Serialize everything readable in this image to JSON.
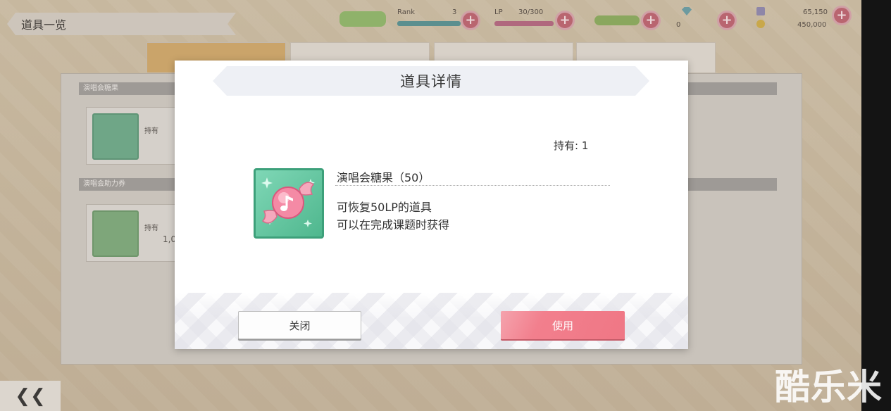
{
  "background": {
    "screen_title": "道具一览",
    "section_1_title": "演唱会糖果",
    "section_2_title": "演唱会助力券",
    "item_1_owned_label": "持有",
    "item_2_owned_label": "持有",
    "item_2_owned_value": "1,0",
    "status": {
      "rank_label": "Rank",
      "rank_value": "3",
      "lp_label": "LP",
      "lp_value": "30/300",
      "gem_count": "0",
      "gold_top": "65,150",
      "gold_bottom": "450,000"
    },
    "back_label": "❮❮"
  },
  "modal": {
    "title": "道具详情",
    "owned_label": "持有",
    "owned_count": "1",
    "item_name": "演唱会糖果（50）",
    "description_line1": "可恢复50LP的道具",
    "description_line2": "可以在完成课题时获得",
    "close_label": "关闭",
    "use_label": "使用"
  },
  "watermark": "酷乐米",
  "colors": {
    "use_button": "#f27f8d",
    "icon_frame": "#4fb78e",
    "candy": "#f08aa3"
  },
  "icons": {
    "item_icon": "candy-icon",
    "music_note": "music-note-icon",
    "back": "double-chevron-left-icon"
  }
}
